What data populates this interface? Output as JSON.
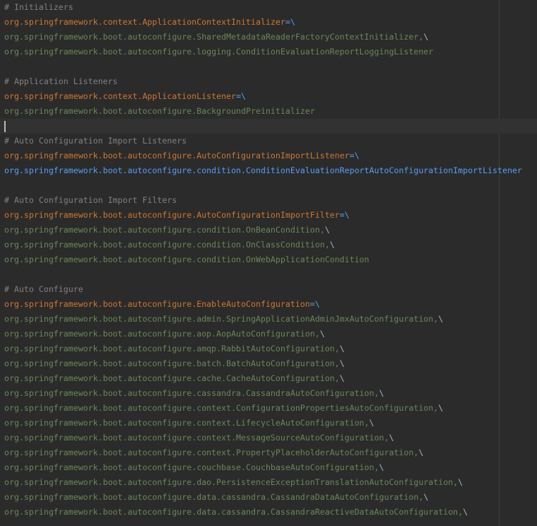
{
  "editor": {
    "lines": [
      {
        "type": "comment",
        "text": "# Initializers"
      },
      {
        "type": "key",
        "text": "org.springframework.context.ApplicationContextInitializer",
        "sep": "=\\"
      },
      {
        "type": "value",
        "text": "org.springframework.boot.autoconfigure.SharedMetadataReaderFactoryContextInitializer,",
        "sep": "\\"
      },
      {
        "type": "value",
        "text": "org.springframework.boot.autoconfigure.logging.ConditionEvaluationReportLoggingListener",
        "sep": ""
      },
      {
        "type": "blank",
        "text": ""
      },
      {
        "type": "comment",
        "text": "# Application Listeners"
      },
      {
        "type": "key",
        "text": "org.springframework.context.ApplicationListener",
        "sep": "=\\"
      },
      {
        "type": "value",
        "text": "org.springframework.boot.autoconfigure.BackgroundPreinitializer",
        "sep": ""
      },
      {
        "type": "current",
        "text": ""
      },
      {
        "type": "comment",
        "text": "# Auto Configuration Import Listeners"
      },
      {
        "type": "key",
        "text": "org.springframework.boot.autoconfigure.AutoConfigurationImportListener",
        "sep": "=\\"
      },
      {
        "type": "highlight",
        "text": "org.springframework.boot.autoconfigure.condition.ConditionEvaluationReportAutoConfigurationImportListener",
        "sep": ""
      },
      {
        "type": "blank",
        "text": ""
      },
      {
        "type": "comment",
        "text": "# Auto Configuration Import Filters"
      },
      {
        "type": "key",
        "text": "org.springframework.boot.autoconfigure.AutoConfigurationImportFilter",
        "sep": "=\\"
      },
      {
        "type": "value",
        "text": "org.springframework.boot.autoconfigure.condition.OnBeanCondition,",
        "sep": "\\"
      },
      {
        "type": "value",
        "text": "org.springframework.boot.autoconfigure.condition.OnClassCondition,",
        "sep": "\\"
      },
      {
        "type": "value",
        "text": "org.springframework.boot.autoconfigure.condition.OnWebApplicationCondition",
        "sep": ""
      },
      {
        "type": "blank",
        "text": ""
      },
      {
        "type": "comment",
        "text": "# Auto Configure"
      },
      {
        "type": "key",
        "text": "org.springframework.boot.autoconfigure.EnableAutoConfiguration",
        "sep": "=\\"
      },
      {
        "type": "value",
        "text": "org.springframework.boot.autoconfigure.admin.SpringApplicationAdminJmxAutoConfiguration,",
        "sep": "\\"
      },
      {
        "type": "value",
        "text": "org.springframework.boot.autoconfigure.aop.AopAutoConfiguration,",
        "sep": "\\"
      },
      {
        "type": "value",
        "text": "org.springframework.boot.autoconfigure.amqp.RabbitAutoConfiguration,",
        "sep": "\\"
      },
      {
        "type": "value",
        "text": "org.springframework.boot.autoconfigure.batch.BatchAutoConfiguration,",
        "sep": "\\"
      },
      {
        "type": "value",
        "text": "org.springframework.boot.autoconfigure.cache.CacheAutoConfiguration,",
        "sep": "\\"
      },
      {
        "type": "value",
        "text": "org.springframework.boot.autoconfigure.cassandra.CassandraAutoConfiguration,",
        "sep": "\\"
      },
      {
        "type": "value",
        "text": "org.springframework.boot.autoconfigure.context.ConfigurationPropertiesAutoConfiguration,",
        "sep": "\\"
      },
      {
        "type": "value",
        "text": "org.springframework.boot.autoconfigure.context.LifecycleAutoConfiguration,",
        "sep": "\\"
      },
      {
        "type": "value",
        "text": "org.springframework.boot.autoconfigure.context.MessageSourceAutoConfiguration,",
        "sep": "\\"
      },
      {
        "type": "value",
        "text": "org.springframework.boot.autoconfigure.context.PropertyPlaceholderAutoConfiguration,",
        "sep": "\\"
      },
      {
        "type": "value",
        "text": "org.springframework.boot.autoconfigure.couchbase.CouchbaseAutoConfiguration,",
        "sep": "\\"
      },
      {
        "type": "value",
        "text": "org.springframework.boot.autoconfigure.dao.PersistenceExceptionTranslationAutoConfiguration,",
        "sep": "\\"
      },
      {
        "type": "value",
        "text": "org.springframework.boot.autoconfigure.data.cassandra.CassandraDataAutoConfiguration,",
        "sep": "\\"
      },
      {
        "type": "value",
        "text": "org.springframework.boot.autoconfigure.data.cassandra.CassandraReactiveDataAutoConfiguration,",
        "sep": "\\"
      }
    ]
  },
  "colors": {
    "background": "#2b2b2b",
    "comment": "#808080",
    "key": "#cc7832",
    "value": "#6a8759",
    "highlight": "#589df6",
    "current_line": "#323232"
  }
}
